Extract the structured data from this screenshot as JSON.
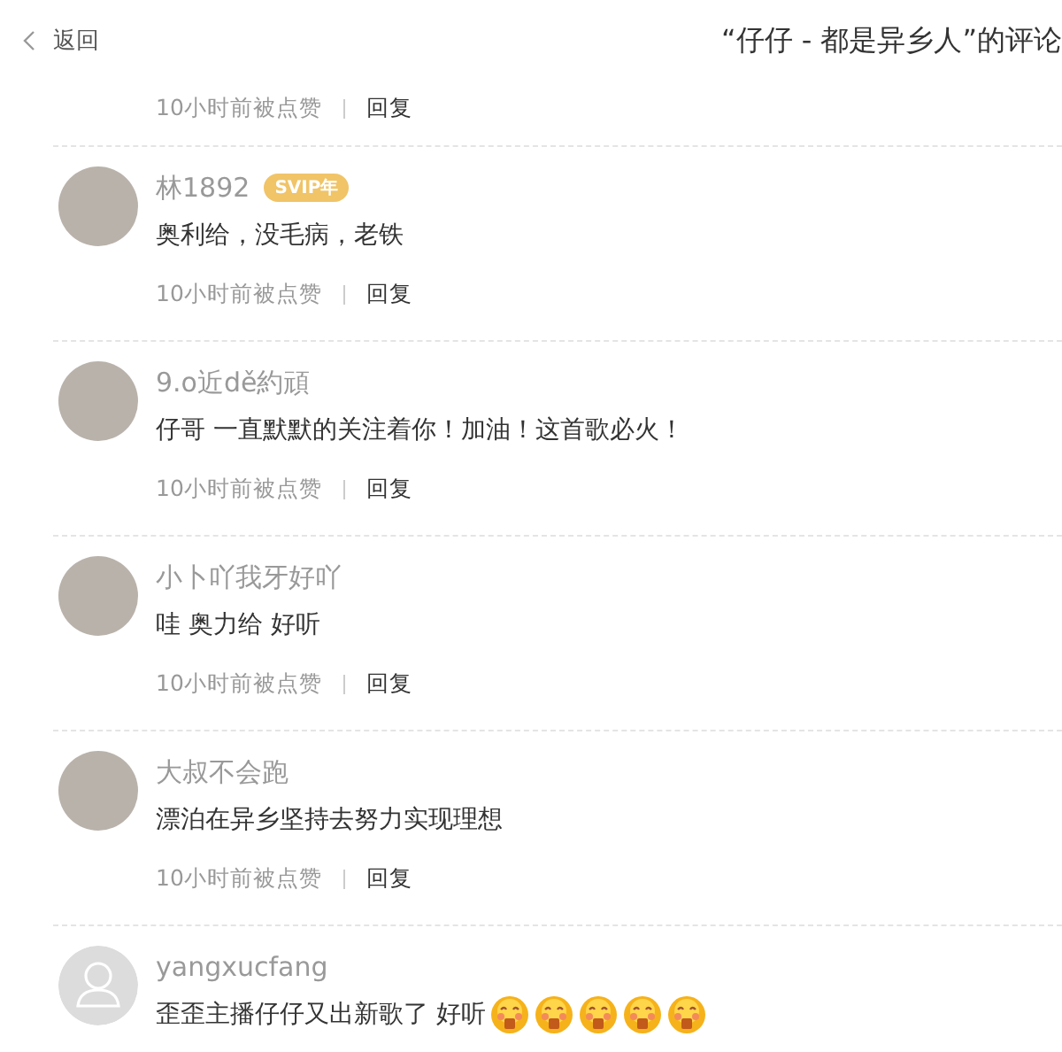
{
  "header": {
    "back_label": "返回",
    "title": "“仔仔 - 都是异乡人”的评论"
  },
  "partial_footer": {
    "time": "10小时前被点赞",
    "reply": "回复"
  },
  "comments": [
    {
      "avatar": {
        "kind": "photo"
      },
      "name": "林1892",
      "badge": "SVIP年",
      "text": "奥利给，没毛病，老铁",
      "time": "10小时前被点赞",
      "reply": "回复"
    },
    {
      "avatar": {
        "kind": "photo"
      },
      "name": "9.o近dě約頑",
      "text": "仔哥 一直默默的关注着你！加油！这首歌必火！",
      "time": "10小时前被点赞",
      "reply": "回复"
    },
    {
      "avatar": {
        "kind": "photo"
      },
      "name": "小卜吖我牙好吖",
      "text": "哇 奥力给 好听",
      "time": "10小时前被点赞",
      "reply": "回复"
    },
    {
      "avatar": {
        "kind": "photo"
      },
      "name": "大叔不会跑",
      "text": "漂泊在异乡坚持去努力实现理想",
      "time": "10小时前被点赞",
      "reply": "回复"
    },
    {
      "avatar": {
        "kind": "default"
      },
      "name": "yangxucfang",
      "text": "歪歪主播仔仔又出新歌了 好听",
      "emoticons": [
        {
          "kind": "grin"
        },
        {
          "kind": "grin"
        },
        {
          "kind": "grin"
        },
        {
          "kind": "grin"
        },
        {
          "kind": "grin"
        }
      ]
    }
  ]
}
